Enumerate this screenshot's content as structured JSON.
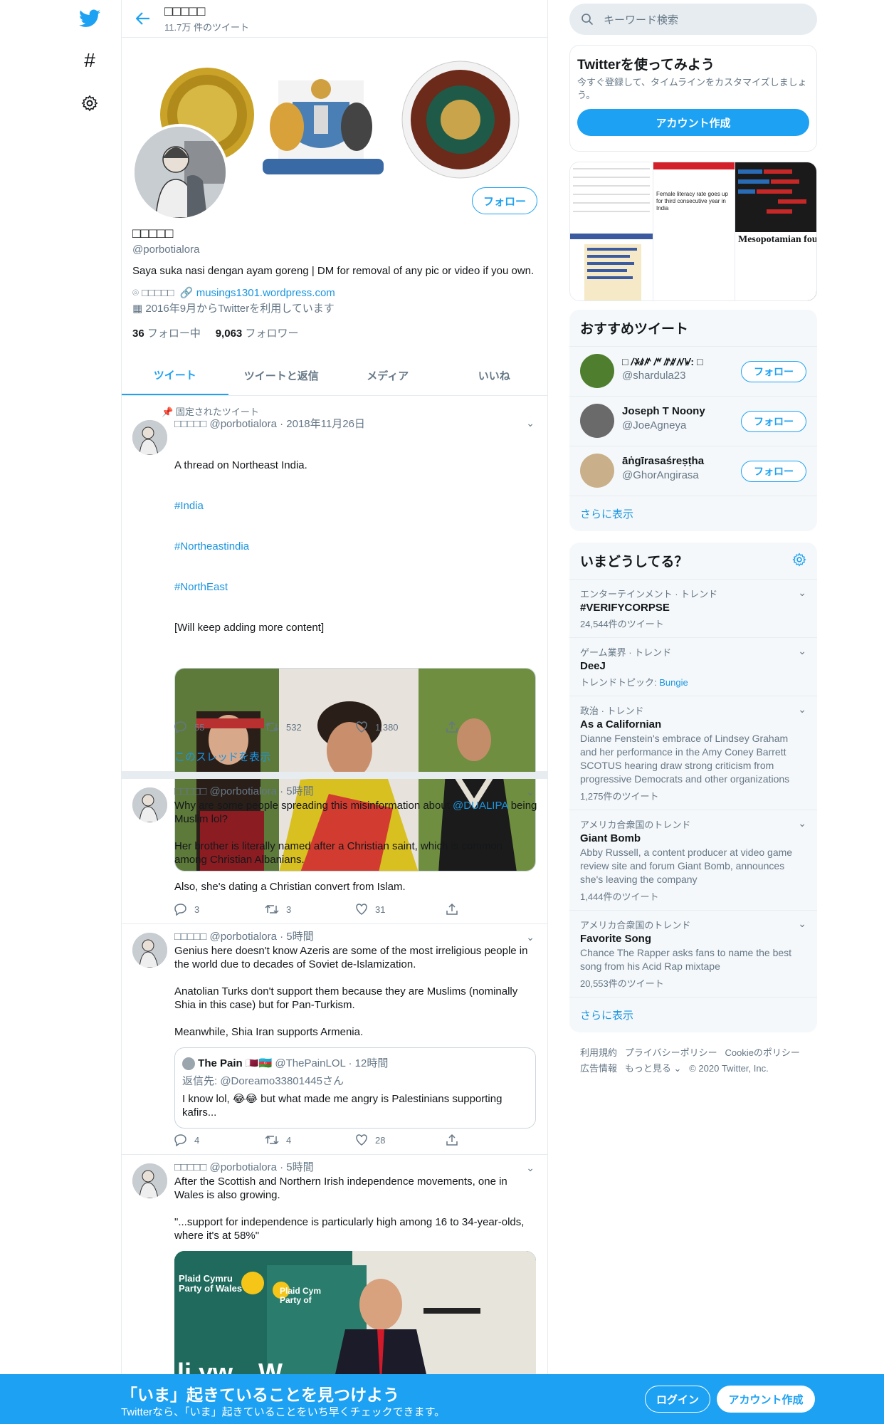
{
  "nav": {
    "twitter_logo": "twitter-bird-icon",
    "explore": "hashtag-icon",
    "settings": "gear-icon"
  },
  "header": {
    "name": "□□□□□",
    "tweet_count": "11.7万 件のツイート"
  },
  "profile": {
    "name": "□□□□□",
    "handle": "@porbotialora",
    "bio": "Saya suka nasi dengan ayam goreng | DM for removal of any pic or video if you own.",
    "location": "□□□□□",
    "website": "musings1301.wordpress.com",
    "joined": "2016年9月からTwitterを利用しています",
    "following_count": "36",
    "following_label": "フォロー中",
    "followers_count": "9,063",
    "followers_label": "フォロワー",
    "follow_button": "フォロー"
  },
  "tabs": [
    "ツイート",
    "ツイートと返信",
    "メディア",
    "いいね"
  ],
  "tweets": [
    {
      "pinned": "固定されたツイート",
      "name": "□□□□□",
      "handle": "@porbotialora",
      "time": "2018年11月26日",
      "text": "A thread on Northeast India.",
      "tags": [
        "#India",
        "#Northeastindia",
        "#NorthEast"
      ],
      "text2": "[Will keep adding more content]",
      "replies": "55",
      "retweets": "532",
      "likes": "1,380",
      "show_thread": "このスレッドを表示"
    },
    {
      "name": "□□□□□",
      "handle": "@porbotialora",
      "time": "5時間",
      "text_a": "Why are some people spreading this misinformation about ",
      "mention": "@DUALIPA",
      "text_b": " being Muslim lol?\n\nHer brother is literally named after a Christian saint, which is common among Christian Albanians.\n\nAlso, she's dating a Christian convert from Islam.",
      "replies": "3",
      "retweets": "3",
      "likes": "31"
    },
    {
      "name": "□□□□□",
      "handle": "@porbotialora",
      "time": "5時間",
      "text": "Genius here doesn't know Azeris are some of the most irreligious people in the world due to decades of Soviet de-Islamization.\n\nAnatolian Turks don't support them because they are Muslims (nominally Shia in this case) but for Pan-Turkism.\n\nMeanwhile, Shia Iran supports Armenia.",
      "quote": {
        "name": "The Pain 🇶🇦🇦🇿",
        "handle": "@ThePainLOL",
        "time": "12時間",
        "reply_to": "返信先: @Doreamo33801445さん",
        "text": "I know lol, 😂😂 but what made me angry is Palestinians supporting kafirs..."
      },
      "replies": "4",
      "retweets": "4",
      "likes": "28"
    },
    {
      "name": "□□□□□",
      "handle": "@porbotialora",
      "time": "5時間",
      "text": "After the Scottish and Northern Irish independence movements, one in Wales is also growing.\n\n\"...support for independence is particularly high among 16 to 34-year-olds, where it's at 58%\"",
      "image_text": [
        "Plaid Cymru",
        "Party of Wales",
        "Plaid Cym",
        "Party of",
        "li yw",
        "W"
      ]
    }
  ],
  "right": {
    "search_placeholder": "キーワード検索",
    "signup_card": {
      "title": "Twitterを使ってみよう",
      "desc": "今すぐ登録して、タイムラインをカスタマイズしましょう。",
      "button": "アカウント作成"
    },
    "media_caption": {
      "title": "Female literacy rate goes up for third consecutive year in India",
      "text": "Mesopotamian founded by vari a couple of mill revolution (Ersa The official"
    },
    "recommend": {
      "title": "おすすめツイート",
      "users": [
        {
          "name": "□ ꤷꤸꤹꤺ ꤻ ꤼꤽꤾꤿ: □",
          "handle": "@shardula23"
        },
        {
          "name": "Joseph T Noony",
          "handle": "@JoeAgneya"
        },
        {
          "name": "āṅgīrasaśreṣṭha",
          "handle": "@GhorAngirasa"
        }
      ],
      "follow": "フォロー",
      "more": "さらに表示"
    },
    "trends": {
      "title": "いまどうしてる？",
      "items": [
        {
          "cat": "エンターテインメント · トレンド",
          "name": "#VERIFYCORPSE",
          "count": "24,544件のツイート"
        },
        {
          "cat": "ゲーム業界 · トレンド",
          "name": "DeeJ",
          "topic_label": "トレンドトピック: ",
          "topic": "Bungie"
        },
        {
          "cat": "政治 · トレンド",
          "name": "As a Californian",
          "desc": "Dianne Fenstein's embrace of Lindsey Graham and her performance in the Amy Coney Barrett SCOTUS hearing draw strong criticism from progressive Democrats and other organizations",
          "count": "1,275件のツイート"
        },
        {
          "cat": "アメリカ合衆国のトレンド",
          "name": "Giant Bomb",
          "desc": "Abby Russell, a content producer at video game review site and forum Giant Bomb, announces she's leaving the company",
          "count": "1,444件のツイート"
        },
        {
          "cat": "アメリカ合衆国のトレンド",
          "name": "Favorite Song",
          "desc": "Chance The Rapper asks fans to name the best song from his Acid Rap mixtape",
          "count": "20,553件のツイート"
        }
      ],
      "more": "さらに表示"
    },
    "footer": {
      "l1": "利用規約",
      "l2": "プライバシーポリシー",
      "l3": "Cookieのポリシー",
      "l4": "広告情報",
      "l5": "もっと見る ⌄",
      "l6": "© 2020 Twitter, Inc."
    }
  },
  "bottom": {
    "title": "「いま」起きていることを見つけよう",
    "sub": "Twitterなら、「いま」起きていることをいち早くチェックできます。",
    "login": "ログイン",
    "signup": "アカウント作成"
  }
}
